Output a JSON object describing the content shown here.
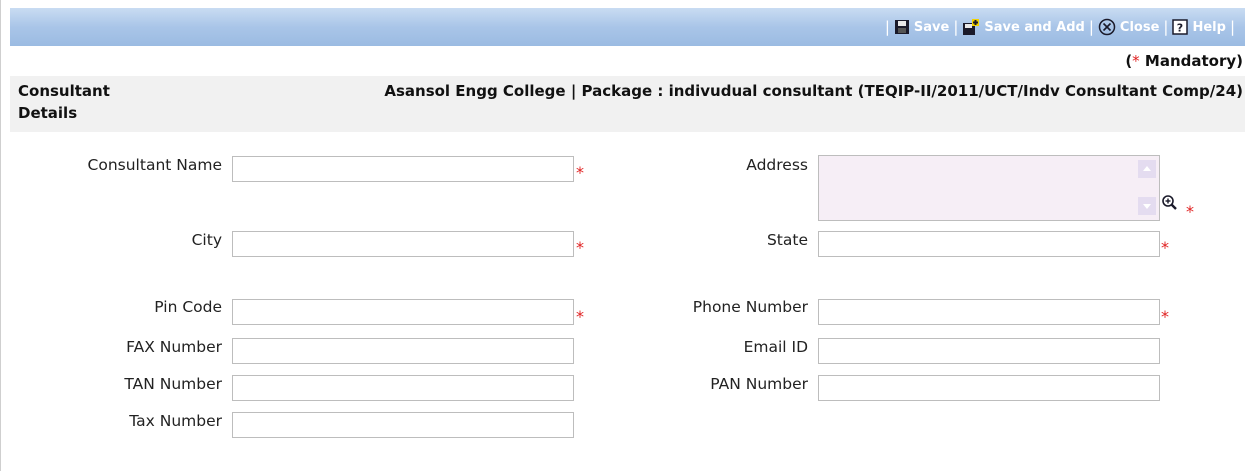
{
  "toolbar": {
    "separator": "|",
    "save_label": "Save",
    "save_and_add_label": "Save and Add",
    "close_label": "Close",
    "help_label": "Help"
  },
  "mandatory": {
    "open": "(",
    "star": "*",
    "label": "Mandatory)"
  },
  "header": {
    "section_title": "Consultant Details",
    "package_info": "Asansol Engg College | Package : indivudual consultant (TEQIP-II/2011/UCT/Indv Consultant Comp/24)"
  },
  "form": {
    "required_marker": "*",
    "consultant_name": {
      "label": "Consultant Name",
      "value": ""
    },
    "address": {
      "label": "Address",
      "value": ""
    },
    "city": {
      "label": "City",
      "value": ""
    },
    "state": {
      "label": "State",
      "value": ""
    },
    "pin_code": {
      "label": "Pin Code",
      "value": ""
    },
    "phone_number": {
      "label": "Phone Number",
      "value": ""
    },
    "fax_number": {
      "label": "FAX Number",
      "value": ""
    },
    "email_id": {
      "label": "Email ID",
      "value": ""
    },
    "tan_number": {
      "label": "TAN Number",
      "value": ""
    },
    "pan_number": {
      "label": "PAN Number",
      "value": ""
    },
    "tax_number": {
      "label": "Tax Number",
      "value": ""
    }
  },
  "icons": [
    "save-icon",
    "save-and-add-icon",
    "close-icon",
    "help-icon",
    "zoom-icon",
    "scroll-up-icon",
    "scroll-down-icon"
  ],
  "colors": {
    "toolbar": "#a9c5e8",
    "required": "#e02020",
    "address_bg": "#f6eef6"
  }
}
